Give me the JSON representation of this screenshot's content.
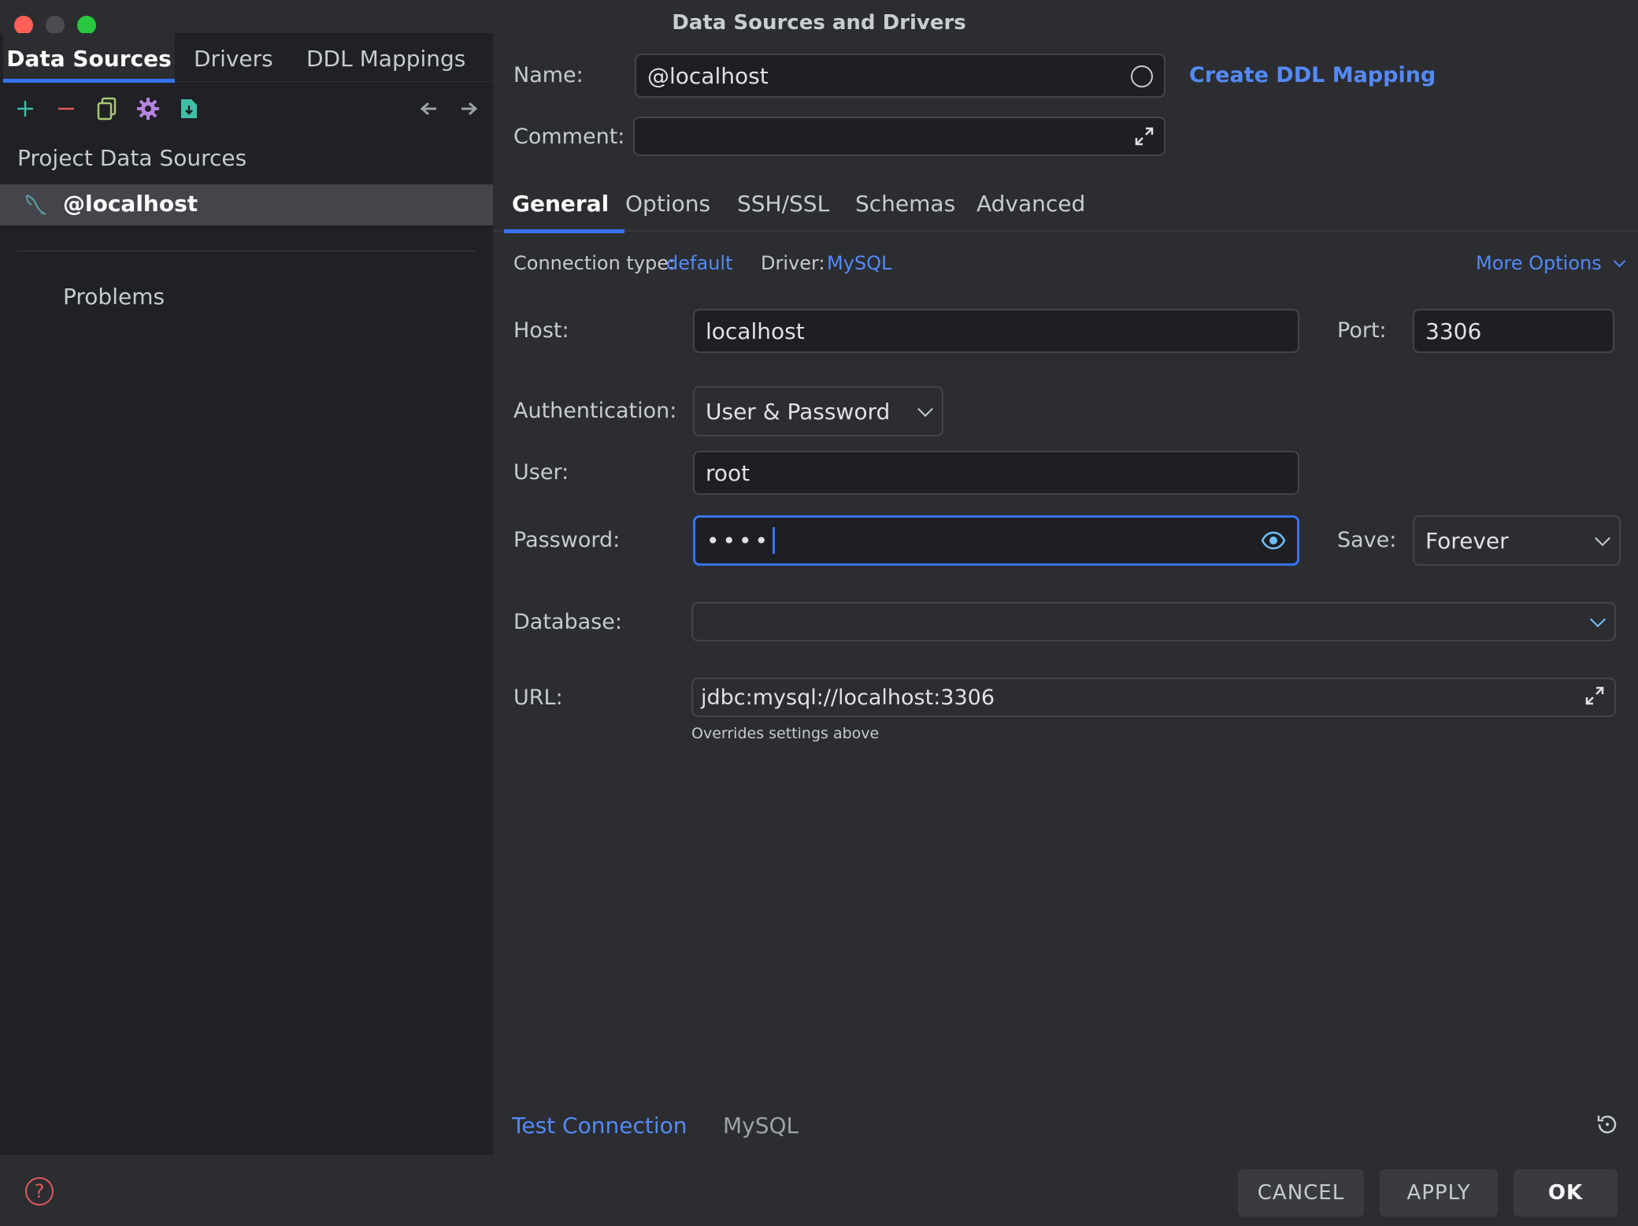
{
  "window": {
    "title": "Data Sources and Drivers"
  },
  "left": {
    "tabs": [
      {
        "label": "Data Sources",
        "active": true
      },
      {
        "label": "Drivers",
        "active": false
      },
      {
        "label": "DDL Mappings",
        "active": false
      }
    ],
    "toolbar": [
      "add-icon",
      "remove-icon",
      "duplicate-icon",
      "settings-icon",
      "import-icon",
      "back-arrow-icon",
      "forward-arrow-icon"
    ],
    "section_title": "Project Data Sources",
    "data_source": "@localhost",
    "problems_label": "Problems"
  },
  "right": {
    "name_label": "Name:",
    "name_value": "@localhost",
    "create_ddl_link": "Create DDL Mapping",
    "comment_label": "Comment:",
    "comment_value": "",
    "tabs": [
      {
        "label": "General",
        "active": true
      },
      {
        "label": "Options",
        "active": false
      },
      {
        "label": "SSH/SSL",
        "active": false
      },
      {
        "label": "Schemas",
        "active": false
      },
      {
        "label": "Advanced",
        "active": false
      }
    ],
    "connection_type_label": "Connection type:",
    "connection_type_value": "default",
    "driver_label": "Driver:",
    "driver_value": "MySQL",
    "more_options": "More Options",
    "host_label": "Host:",
    "host_value": "localhost",
    "port_label": "Port:",
    "port_value": "3306",
    "auth_label": "Authentication:",
    "auth_value": "User & Password",
    "user_label": "User:",
    "user_value": "root",
    "password_label": "Password:",
    "password_value": "••••",
    "save_label": "Save:",
    "save_value": "Forever",
    "database_label": "Database:",
    "database_value": "",
    "url_label": "URL:",
    "url_value": "jdbc:mysql://localhost:3306",
    "url_hint": "Overrides settings above",
    "test_connection": "Test Connection",
    "driver_footer": "MySQL"
  },
  "buttons": {
    "cancel": "CANCEL",
    "apply": "APPLY",
    "ok": "OK"
  },
  "colors": {
    "accent": "#3574f0",
    "link": "#548af7",
    "panel_dark": "#1f2124",
    "panel": "#2b2d30"
  }
}
